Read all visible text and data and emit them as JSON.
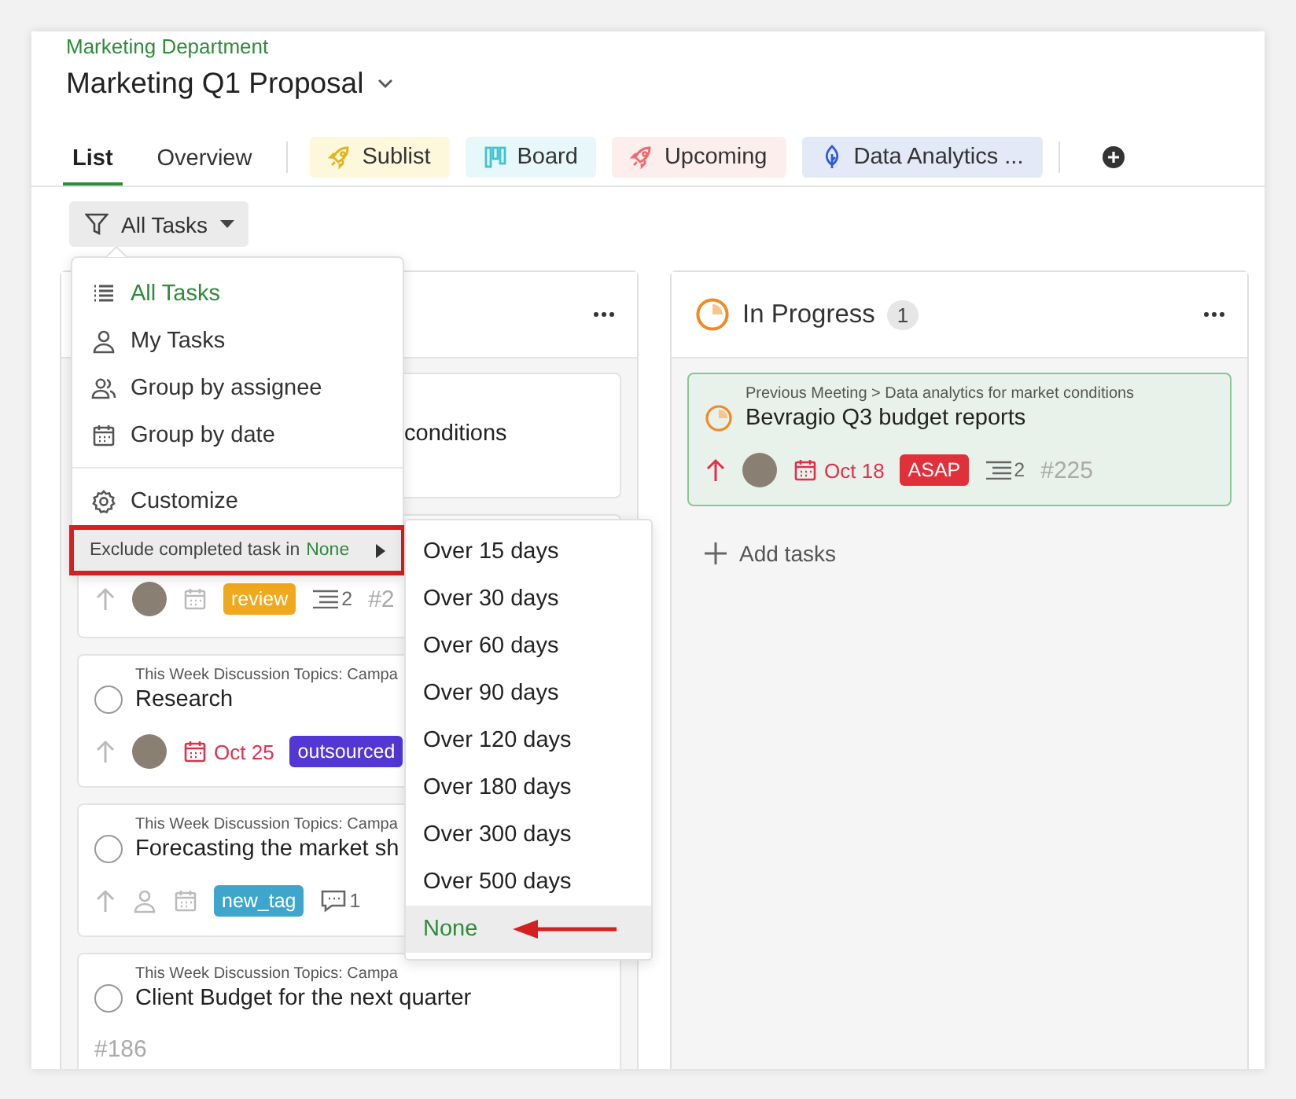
{
  "breadcrumb": "Marketing Department",
  "project_title": "Marketing Q1 Proposal",
  "view_tabs": [
    {
      "label": "List",
      "selected": true,
      "kind": "plain"
    },
    {
      "label": "Overview",
      "selected": false,
      "kind": "plain"
    },
    {
      "label": "Sublist",
      "selected": false,
      "kind": "rocket",
      "color": "#fdf7dc"
    },
    {
      "label": "Board",
      "selected": false,
      "kind": "board",
      "color": "#e8f8fa"
    },
    {
      "label": "Upcoming",
      "selected": false,
      "kind": "rocket",
      "color": "#fdeeee"
    },
    {
      "label": "Data Analytics ...",
      "selected": false,
      "kind": "leaf",
      "color": "#e3e9f7"
    }
  ],
  "filter_button": {
    "label": "All Tasks"
  },
  "filter_menu": {
    "items": [
      {
        "label": "All Tasks",
        "selected": true,
        "kind": "list"
      },
      {
        "label": "My Tasks",
        "selected": false,
        "kind": "person"
      },
      {
        "label": "Group by assignee",
        "selected": false,
        "kind": "people"
      },
      {
        "label": "Group by date",
        "selected": false,
        "kind": "calendar"
      }
    ],
    "customize": "Customize",
    "exclude": {
      "label": "Exclude completed task in",
      "value": "None",
      "highlighted": true
    }
  },
  "exclude_submenu": [
    {
      "label": "Over 15 days",
      "selected": false,
      "annotated": false
    },
    {
      "label": "Over 30 days",
      "selected": false,
      "annotated": false
    },
    {
      "label": "Over 60 days",
      "selected": false,
      "annotated": false
    },
    {
      "label": "Over 90 days",
      "selected": false,
      "annotated": false
    },
    {
      "label": "Over 120 days",
      "selected": false,
      "annotated": false
    },
    {
      "label": "Over 180 days",
      "selected": false,
      "annotated": false
    },
    {
      "label": "Over 300 days",
      "selected": false,
      "annotated": false
    },
    {
      "label": "Over 500 days",
      "selected": false,
      "annotated": false
    },
    {
      "label": "None",
      "selected": true,
      "annotated": true
    }
  ],
  "columns": [
    {
      "cards": [
        {
          "kind": "covered",
          "title": "conditions"
        },
        {
          "kind": "meta_only",
          "high_priority": false,
          "has_assignee": true,
          "tag": {
            "label": "review",
            "color": "#f0a81c"
          },
          "subtasks": "2",
          "id": "#2"
        },
        {
          "kind": "full",
          "in_progress": false,
          "done": false,
          "path": "This Week Discussion Topics: Campa",
          "title": "Research",
          "high_priority": false,
          "has_assignee": true,
          "date": "Oct 25",
          "tag": {
            "label": "outsourced",
            "color": "#5236d6"
          }
        },
        {
          "kind": "full",
          "in_progress": false,
          "done": false,
          "path": "This Week Discussion Topics: Campa",
          "title": "Forecasting the market sh",
          "high_priority": false,
          "has_assignee": false,
          "tag": {
            "label": "new_tag",
            "color": "#3ea6cc"
          },
          "comments": "1"
        },
        {
          "kind": "id_only",
          "in_progress": false,
          "done": false,
          "path": "This Week Discussion Topics: Campa",
          "title": "Client Budget for the next quarter",
          "id": "#186"
        }
      ]
    },
    {
      "title": "In Progress",
      "count": "1",
      "cards": [
        {
          "kind": "full",
          "in_progress": true,
          "path": "Previous Meeting > Data analytics for market conditions",
          "title": "Bevragio Q3 budget reports",
          "high_priority": true,
          "has_assignee": true,
          "date": "Oct 18",
          "tag": {
            "label": "ASAP",
            "color": "#e0303a"
          },
          "subtasks": "2",
          "id": "#225"
        }
      ],
      "add_label": "Add tasks"
    }
  ]
}
